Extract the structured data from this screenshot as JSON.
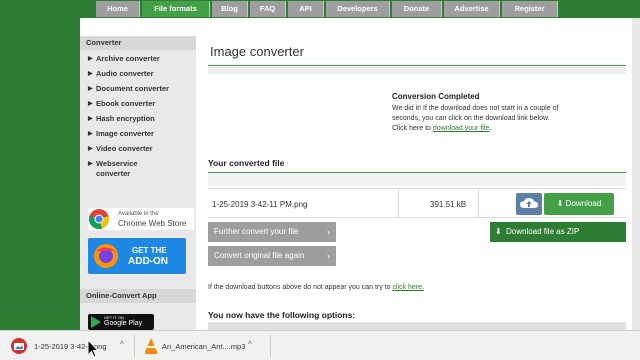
{
  "nav": {
    "items": [
      "Home",
      "File formats",
      "Blog",
      "FAQ",
      "API",
      "Developers",
      "Donate",
      "Advertise",
      "Register"
    ],
    "active": "File formats"
  },
  "sidebar": {
    "heading": "Converter",
    "links": [
      "Archive converter",
      "Audio converter",
      "Document converter",
      "Ebook converter",
      "Hash encryption",
      "Image converter",
      "Video converter",
      "Webservice converter"
    ],
    "chrome_badge": [
      "Available in the",
      "Chrome Web Store"
    ],
    "firefox_badge": [
      "GET THE",
      "ADD-ON"
    ],
    "app_heading": "Online-Convert App",
    "gplay_badge": [
      "GET IT ON",
      "Google Play"
    ]
  },
  "main": {
    "title": "Image converter",
    "conversion_title": "Conversion Completed",
    "conversion_message": "We did it! If the download does not start in a couple of seconds, you can click on the download link below. Click here to ",
    "conversion_link": "download your file",
    "conversion_end": ".",
    "converted_heading": "Your converted file",
    "file": {
      "name": "1-25-2019 3-42-11 PM.png",
      "size": "391.51 kB"
    },
    "download_label": "Download",
    "zip_label": "Download file as ZIP",
    "further_label": "Further convert your file",
    "again_label": "Convert original file again",
    "trouble_text": "If the download buttons above do not appear you can try to ",
    "trouble_link": "click here.",
    "options_heading": "You now have the following options:"
  },
  "shelf": {
    "items": [
      {
        "name": "1-25-2019 3-42-...png",
        "icon": "image-file-icon"
      },
      {
        "name": "An_American_Ant....mp3",
        "icon": "vlc-icon"
      }
    ]
  },
  "colors": {
    "brand_green": "#2e7d32",
    "accent_green": "#43a047",
    "nav_gray": "#9e9e9e",
    "cloud_blue": "#5e7fa6"
  }
}
